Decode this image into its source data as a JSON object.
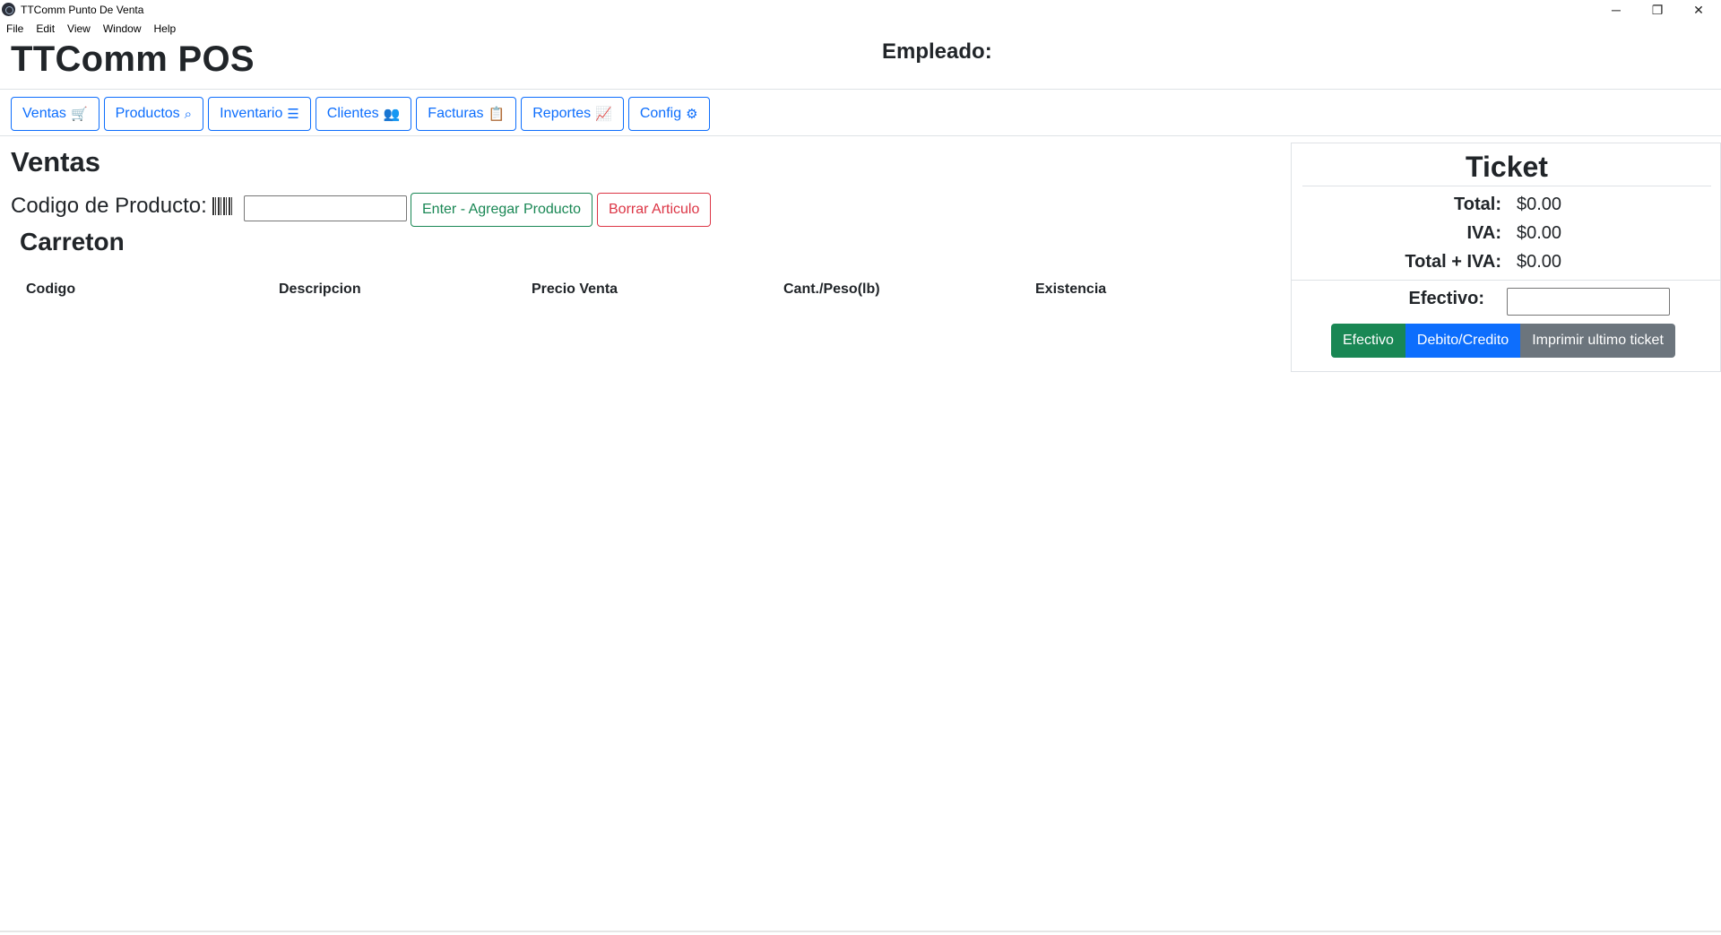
{
  "window": {
    "title": "TTComm Punto De Venta",
    "controls": {
      "minimize": "─",
      "maximize": "❐",
      "close": "✕"
    }
  },
  "menubar": {
    "items": [
      "File",
      "Edit",
      "View",
      "Window",
      "Help"
    ]
  },
  "header": {
    "brand": "TTComm POS",
    "employee_label": "Empleado:"
  },
  "nav": {
    "items": [
      {
        "label": "Ventas",
        "icon": "shopping-cart-icon",
        "glyph": "🛒"
      },
      {
        "label": "Productos",
        "icon": "search-icon",
        "glyph": "⌕"
      },
      {
        "label": "Inventario",
        "icon": "list-icon",
        "glyph": "☰"
      },
      {
        "label": "Clientes",
        "icon": "users-icon",
        "glyph": "👥"
      },
      {
        "label": "Facturas",
        "icon": "clipboard-icon",
        "glyph": "📋"
      },
      {
        "label": "Reportes",
        "icon": "chart-line-icon",
        "glyph": "📈"
      },
      {
        "label": "Config",
        "icon": "gear-icon",
        "glyph": "⚙"
      }
    ],
    "accent": "#0d6efd"
  },
  "sales": {
    "title": "Ventas",
    "code_label": "Codigo de Producto:",
    "code_value": "",
    "add_button": "Enter - Agregar Producto",
    "delete_button": "Borrar Articulo",
    "cart_title": "Carreton",
    "columns": [
      "Codigo",
      "Descripcion",
      "Precio Venta",
      "Cant./Peso(lb)",
      "Existencia"
    ],
    "rows": []
  },
  "ticket": {
    "title": "Ticket",
    "total_label": "Total:",
    "total_value": "$0.00",
    "iva_label": "IVA:",
    "iva_value": "$0.00",
    "total_iva_label": "Total + IVA:",
    "total_iva_value": "$0.00",
    "cash_label": "Efectivo:",
    "cash_value": "",
    "buttons": {
      "cash": "Efectivo",
      "card": "Debito/Credito",
      "print": "Imprimir ultimo ticket"
    },
    "colors": {
      "success": "#198754",
      "primary": "#0d6efd",
      "secondary": "#6c757d"
    }
  }
}
